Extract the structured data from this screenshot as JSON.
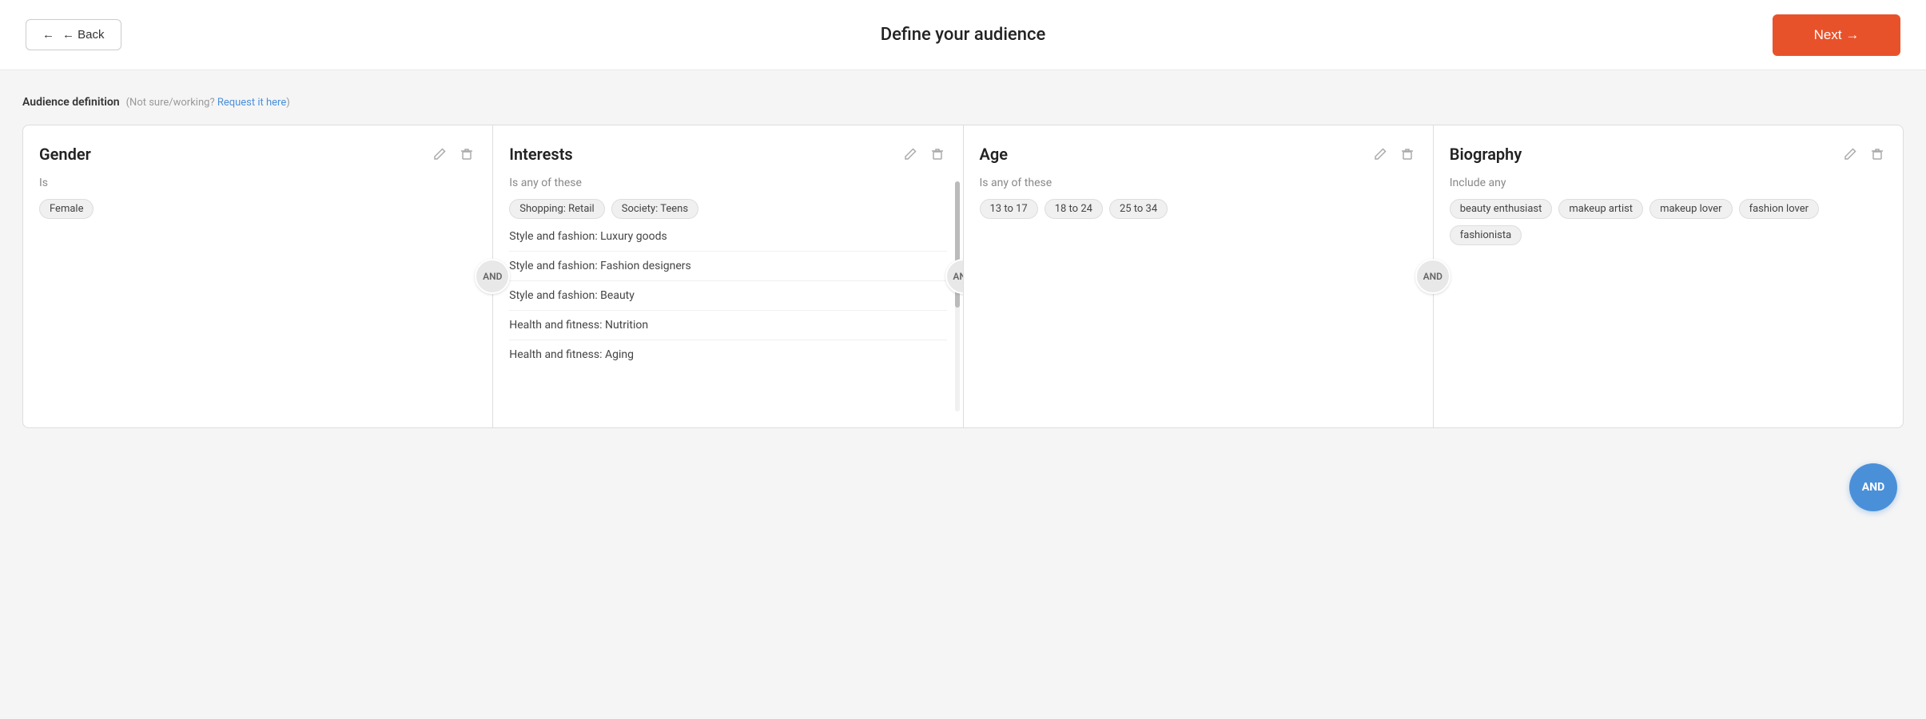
{
  "header": {
    "back_label": "← Back",
    "title": "Define your audience",
    "next_label": "Next →"
  },
  "audience_section": {
    "label": "Audience definition",
    "sub_text": "(Not sure/working? Request it here)"
  },
  "cards": [
    {
      "id": "gender",
      "title": "Gender",
      "condition": "Is",
      "tags": [
        "Female"
      ],
      "type": "tags"
    },
    {
      "id": "interests",
      "title": "Interests",
      "condition": "Is any of these",
      "items": [
        "Shopping: Retail",
        "Society: Teens",
        "Style and fashion: Luxury goods",
        "Style and fashion: Fashion designers",
        "Style and fashion: Beauty",
        "Health and fitness: Nutrition",
        "Health and fitness: Aging"
      ],
      "type": "list-with-inline"
    },
    {
      "id": "age",
      "title": "Age",
      "condition": "Is any of these",
      "tags": [
        "13 to 17",
        "18 to 24",
        "25 to 34"
      ],
      "type": "tags"
    },
    {
      "id": "biography",
      "title": "Biography",
      "condition": "Include any",
      "tags": [
        "beauty enthusiast",
        "makeup artist",
        "makeup lover",
        "fashion lover",
        "fashionista"
      ],
      "type": "tags"
    }
  ],
  "and_badges": {
    "label": "AND",
    "blue_label": "AND"
  },
  "icons": {
    "back_arrow": "←",
    "next_arrow": "→",
    "edit": "✏",
    "trash": "🗑"
  }
}
